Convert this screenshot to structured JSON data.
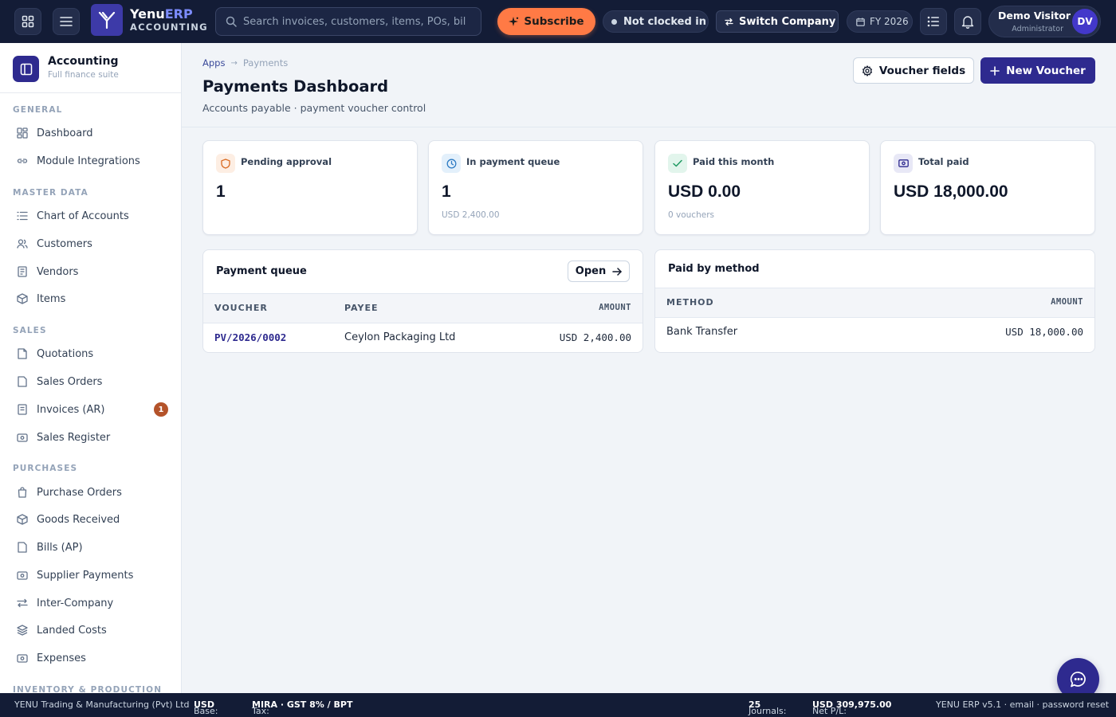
{
  "topbar": {
    "brand_name": "Yenu",
    "brand_name_accent": "ERP",
    "brand_sub": "ACCOUNTING",
    "search_placeholder": "Search invoices, customers, items, POs, bills…",
    "subscribe_label": "Subscribe",
    "clock_status": "Not clocked in",
    "switch_company_label": "Switch Company",
    "fiscal_year": "FY 2026",
    "user_name": "Demo Visitor",
    "user_role": "Administrator",
    "user_initials": "DV"
  },
  "sidebar": {
    "title": "Accounting",
    "subtitle": "Full finance suite",
    "sections": {
      "general": "GENERAL",
      "master_data": "MASTER DATA",
      "sales": "SALES",
      "purchases": "PURCHASES",
      "inventory": "INVENTORY & PRODUCTION"
    },
    "items": {
      "dashboard": "Dashboard",
      "module_integrations": "Module Integrations",
      "chart_of_accounts": "Chart of Accounts",
      "customers": "Customers",
      "vendors": "Vendors",
      "items": "Items",
      "quotations": "Quotations",
      "sales_orders": "Sales Orders",
      "invoices_ar": "Invoices (AR)",
      "invoices_ar_badge": "1",
      "sales_register": "Sales Register",
      "purchase_orders": "Purchase Orders",
      "goods_received": "Goods Received",
      "bills_ap": "Bills (AP)",
      "supplier_payments": "Supplier Payments",
      "inter_company": "Inter-Company",
      "landed_costs": "Landed Costs",
      "expenses": "Expenses"
    }
  },
  "header": {
    "breadcrumb_root": "Apps",
    "breadcrumb_current": "Payments",
    "title": "Payments Dashboard",
    "subtitle": "Accounts payable · payment voucher control",
    "voucher_fields_label": "Voucher fields",
    "new_voucher_label": "New Voucher"
  },
  "kpis": {
    "pending": {
      "label": "Pending approval",
      "value": "1",
      "note": ""
    },
    "queue": {
      "label": "In payment queue",
      "value": "1",
      "note": "USD 2,400.00"
    },
    "paid_month": {
      "label": "Paid this month",
      "value": "USD 0.00",
      "note": "0 vouchers"
    },
    "total_paid": {
      "label": "Total paid",
      "value": "USD 18,000.00",
      "note": ""
    }
  },
  "payment_queue": {
    "title": "Payment queue",
    "open_label": "Open",
    "columns": {
      "voucher": "VOUCHER",
      "payee": "PAYEE",
      "amount": "AMOUNT"
    },
    "rows": [
      {
        "voucher": "PV/2026/0002",
        "payee": "Ceylon Packaging Ltd",
        "amount": "USD 2,400.00"
      }
    ]
  },
  "paid_by_method": {
    "title": "Paid by method",
    "columns": {
      "method": "METHOD",
      "amount": "AMOUNT"
    },
    "rows": [
      {
        "method": "Bank Transfer",
        "amount": "USD 18,000.00"
      }
    ]
  },
  "footer": {
    "company": "YENU Trading & Manufacturing (Pvt) Ltd",
    "base_label": "Base:",
    "base_value": "USD",
    "tax_label": "Tax:",
    "tax_value": "MIRA · GST 8% / BPT",
    "journals_label": "Journals:",
    "journals_value": "25",
    "netpl_label": "Net P/L:",
    "netpl_value": "USD 309,975.00",
    "version": "YENU ERP v5.1 · email · password reset"
  },
  "colors": {
    "topbar_bg": "#131c36",
    "primary": "#2e2a8f",
    "subscribe": "#ff7a45",
    "badge": "#b4532a",
    "page_bg": "#f1f4f8"
  }
}
